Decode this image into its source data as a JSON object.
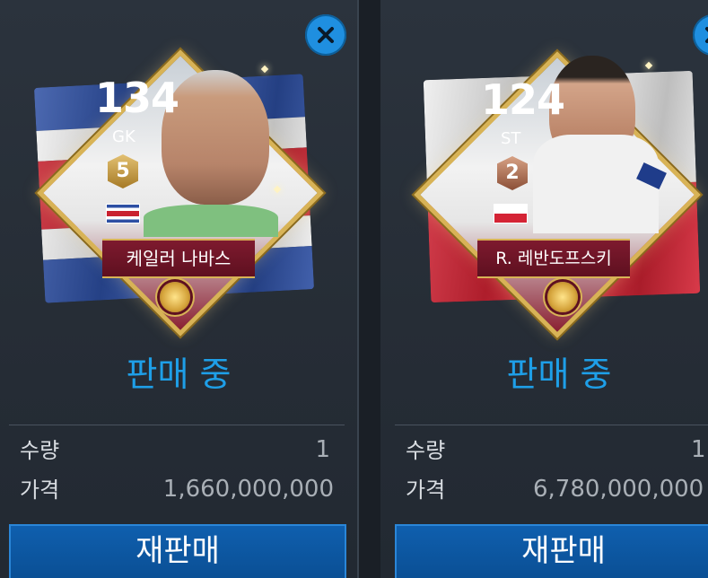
{
  "cards": [
    {
      "rating": "134",
      "position": "GK",
      "level": "5",
      "name": "케일러 나바스",
      "status": "판매 중",
      "quantity_label": "수량",
      "quantity_value": "1",
      "price_label": "가격",
      "price_value": "1,660,000,000",
      "resell_label": "재판매",
      "nation_flag": "costa-rica-flag"
    },
    {
      "rating": "124",
      "position": "ST",
      "level": "2",
      "name": "R. 레반도프스키",
      "status": "판매 중",
      "quantity_label": "수량",
      "quantity_value": "1",
      "price_label": "가격",
      "price_value": "6,780,000,000",
      "resell_label": "재판매",
      "nation_flag": "poland-flag"
    }
  ],
  "icons": {
    "close": "close-icon",
    "ball": "soccer-ball-icon"
  },
  "colors": {
    "accent_blue": "#1e9fe8",
    "button_blue": "#0f5fae",
    "card_gold": "#d8b356",
    "card_maroon": "#7e1a2e"
  }
}
